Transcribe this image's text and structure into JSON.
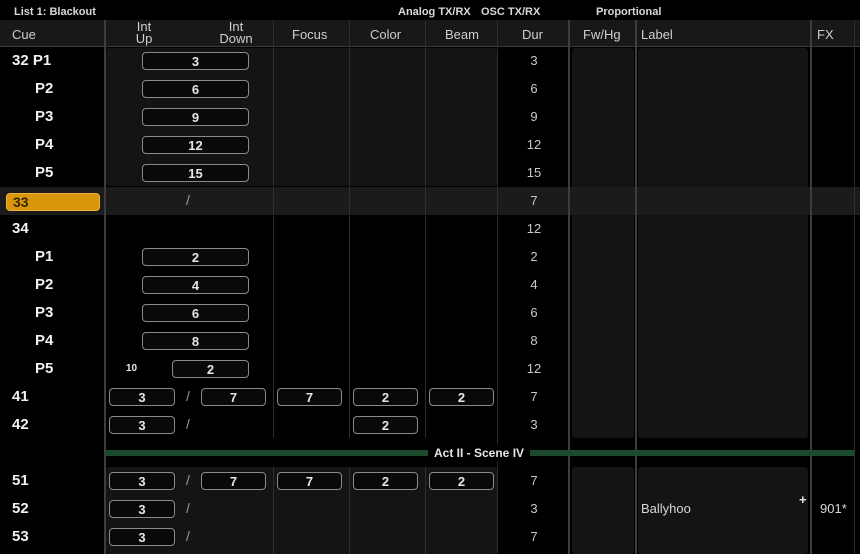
{
  "top": {
    "list_title": "List 1: Blackout",
    "analog": "Analog TX/RX",
    "osc": "OSC TX/RX",
    "mode": "Proportional"
  },
  "headers": {
    "cue": "Cue",
    "int_up_1": "Int",
    "int_up_2": "Up",
    "int_down_1": "Int",
    "int_down_2": "Down",
    "focus": "Focus",
    "color": "Color",
    "beam": "Beam",
    "dur": "Dur",
    "fwhg": "Fw/Hg",
    "label": "Label",
    "fx": "FX"
  },
  "rows": [
    {
      "cue": "32 P1",
      "up": "3",
      "dur": "3"
    },
    {
      "cue": "P2",
      "up": "6",
      "dur": "6"
    },
    {
      "cue": "P3",
      "up": "9",
      "dur": "9"
    },
    {
      "cue": "P4",
      "up": "12",
      "dur": "12"
    },
    {
      "cue": "P5",
      "up": "15",
      "dur": "15"
    },
    {
      "cue": "33",
      "slash": "/",
      "dur": "7",
      "selected": true
    },
    {
      "cue": "34",
      "dur": "12"
    },
    {
      "cue": "P1",
      "up": "2",
      "dur": "2"
    },
    {
      "cue": "P2",
      "up": "4",
      "dur": "4"
    },
    {
      "cue": "P3",
      "up": "6",
      "dur": "6"
    },
    {
      "cue": "P4",
      "up": "8",
      "dur": "8"
    },
    {
      "cue": "P5",
      "delay": "10",
      "up": "2",
      "dur": "12"
    },
    {
      "cue": "41",
      "up": "3",
      "down": "7",
      "focus": "7",
      "color": "2",
      "beam": "2",
      "dur": "7"
    },
    {
      "cue": "42",
      "up": "3",
      "color": "2",
      "dur": "3"
    },
    {
      "cue": "51",
      "up": "3",
      "down": "7",
      "focus": "7",
      "color": "2",
      "beam": "2",
      "dur": "7"
    },
    {
      "cue": "52",
      "up": "3",
      "dur": "3",
      "label": "Ballyhoo",
      "label_mark": "+",
      "fx": "901*"
    },
    {
      "cue": "53",
      "up": "3",
      "dur": "7"
    }
  ],
  "scene_divider": "Act II - Scene IV",
  "colors": {
    "selection": "#d8960a",
    "divider": "#1d4a2c"
  }
}
